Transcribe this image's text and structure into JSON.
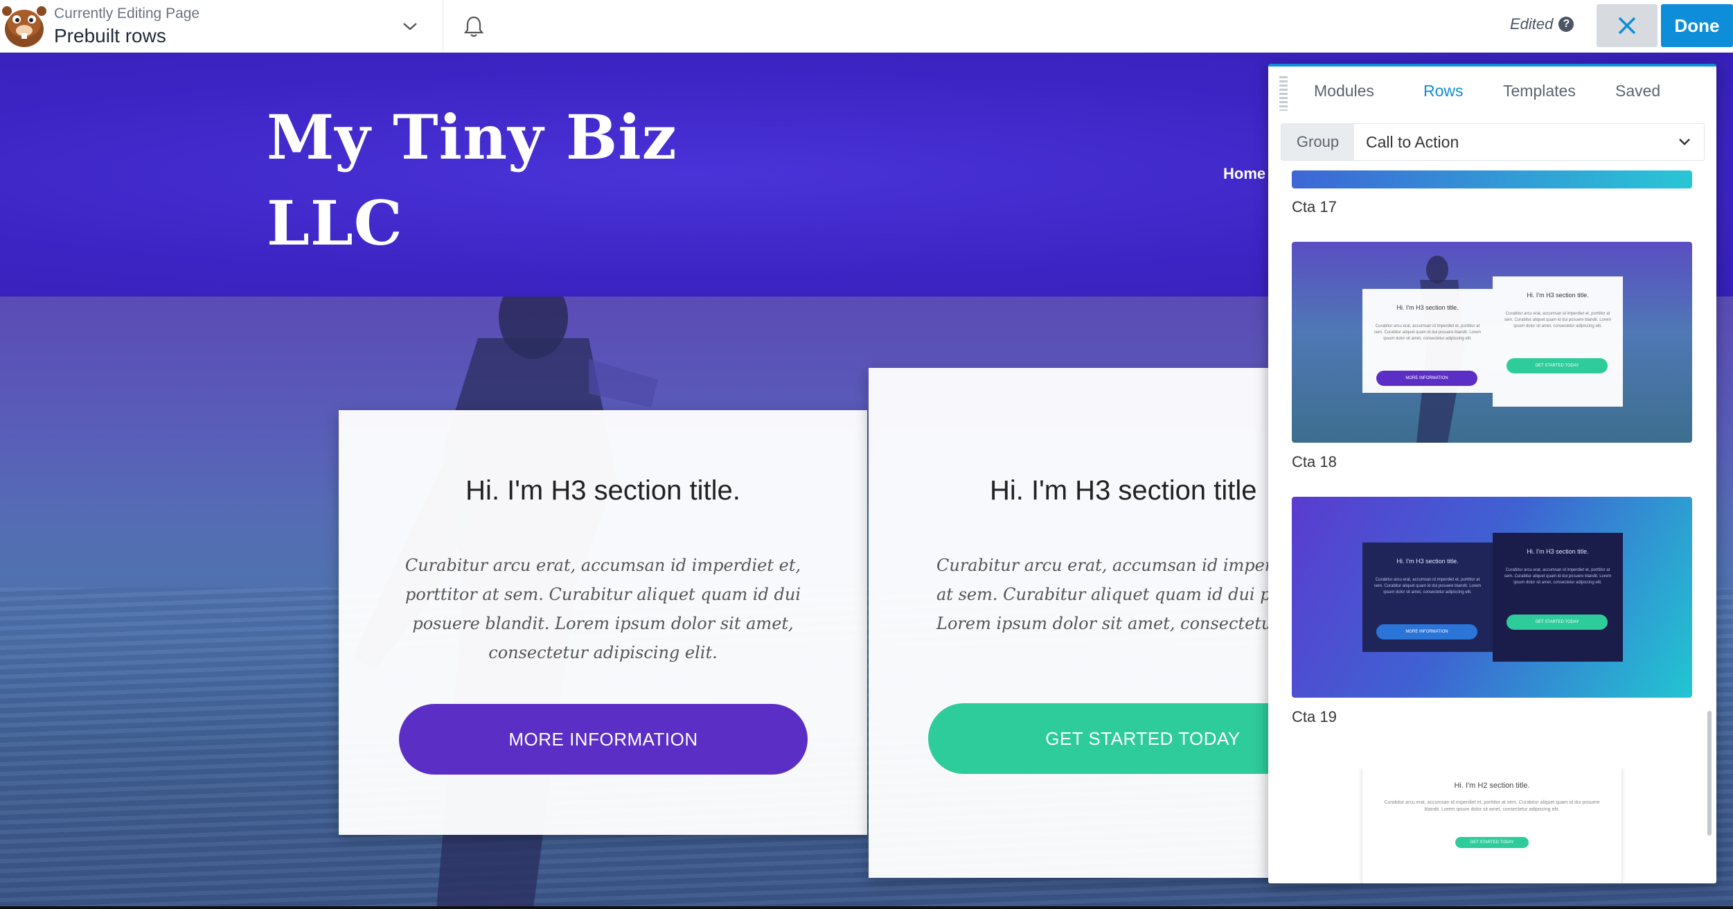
{
  "toolbar": {
    "editing_label": "Currently Editing Page",
    "page_name": "Prebuilt rows",
    "status": "Edited",
    "help_glyph": "?",
    "done_label": "Done"
  },
  "site": {
    "brand_line1": "My Tiny Biz",
    "brand_line2": "LLC",
    "nav_home": "Home"
  },
  "cards": [
    {
      "title": "Hi. I'm H3 section title.",
      "body": "Curabitur arcu erat, accumsan id imperdiet et, porttitor at sem. Curabitur aliquet quam id dui posuere blandit. Lorem ipsum dolor sit amet, consectetur adipiscing elit.",
      "button": "More Information",
      "button_color": "#5b2ec6"
    },
    {
      "title": "Hi. I'm H3 section title",
      "body_lines": [
        "Curabitur arcu erat, accumsan id imperdiet et,",
        "at sem. Curabitur aliquet quam id dui posuere",
        "Lorem ipsum dolor sit amet, consectetur adipis"
      ],
      "button": "Get Started Today",
      "button_color": "#2fcc9b"
    }
  ],
  "panel": {
    "tabs": [
      "Modules",
      "Rows",
      "Templates",
      "Saved"
    ],
    "active_tab": "Rows",
    "group_label": "Group",
    "group_value": "Call to Action",
    "rows": [
      {
        "label": "Cta 17"
      },
      {
        "label": "Cta 18"
      },
      {
        "label": "Cta 19"
      }
    ],
    "mini": {
      "h3": "Hi. I'm H3 section title.",
      "h2": "Hi. I'm H2 section title.",
      "body": "Curabitur arcu erat, accumsan id imperdiet et, porttitor at sem. Curabitur aliquet quam id dui posuere blandit. Lorem ipsum dolor sit amet, consectetur adipiscing elit.",
      "btn_more": "MORE INFORMATION",
      "btn_start": "GET STARTED TODAY"
    }
  },
  "colors": {
    "accent": "#0e8ed8",
    "header_purple": "#3d25c5",
    "cta_purple": "#5b2ec6",
    "cta_green": "#2fcc9b"
  }
}
